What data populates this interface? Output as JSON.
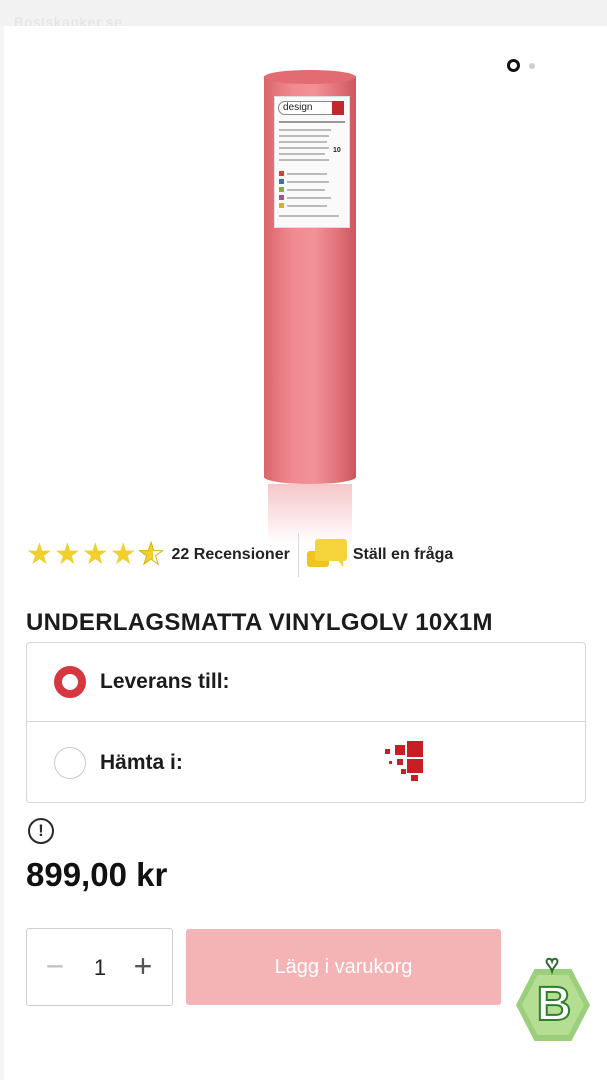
{
  "site": {
    "name": "Bostskanker.se"
  },
  "gallery": {
    "product_label_brand": "design",
    "product_label_number": "10",
    "current_image": 1,
    "image_count": 2
  },
  "rating": {
    "value": 4.5,
    "max": 5,
    "reviews_text": "22 Recensioner",
    "ask_text": "Ställ en fråga"
  },
  "product": {
    "title": "UNDERLAGSMATTA VINYLGOLV 10X1M",
    "price": "899,00 kr"
  },
  "delivery": {
    "options": [
      {
        "label": "Leverans till:",
        "selected": true
      },
      {
        "label": "Hämta i:",
        "selected": false
      }
    ]
  },
  "notice": {
    "icon": "!"
  },
  "purchase": {
    "quantity": "1",
    "minus": "−",
    "plus": "+",
    "add_to_cart": "Lägg i varukorg"
  },
  "colors": {
    "accent": "#d5383f",
    "button_disabled": "#f4b4b6",
    "star": "#f2d02a"
  }
}
